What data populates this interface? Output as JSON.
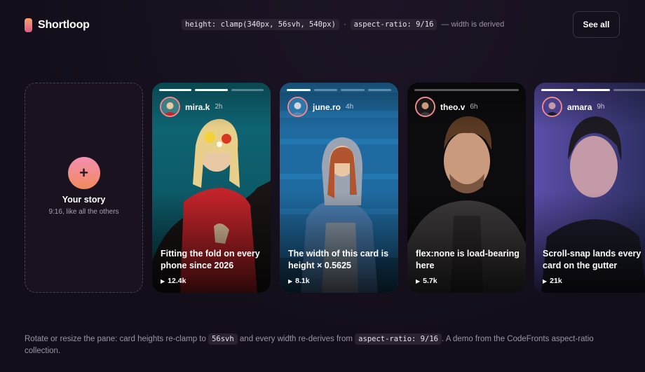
{
  "app": {
    "name": "Shortloop"
  },
  "header": {
    "code_height": "height: clamp(340px, 56svh, 540px)",
    "separator": "·",
    "code_ratio": "aspect-ratio: 9/16",
    "derived_note": "— width is derived",
    "see_all_label": "See all"
  },
  "your_story": {
    "plus": "+",
    "title": "Your story",
    "subtitle": "9:16, like all the others"
  },
  "stories": [
    {
      "user": "mira.k",
      "age": "2h",
      "caption": "Fitting the fold on every phone since 2026",
      "views": "12.4k",
      "progress": [
        1,
        1,
        0
      ]
    },
    {
      "user": "june.ro",
      "age": "4h",
      "caption": "The width of this card is height × 0.5625",
      "views": "8.1k",
      "progress": [
        1,
        0,
        0,
        0
      ]
    },
    {
      "user": "theo.v",
      "age": "6h",
      "caption": "flex:none is load-bearing here",
      "views": "5.7k",
      "progress": [
        0
      ]
    },
    {
      "user": "amara",
      "age": "9h",
      "caption": "Scroll-snap lands every card on the gutter",
      "views": "21k",
      "progress": [
        1,
        1,
        0
      ]
    }
  ],
  "play_icon": "▶",
  "footer": {
    "text1": "Rotate or resize the pane: card heights re-clamp to",
    "code1": "56svh",
    "text2": "and every width re-derives from",
    "code2": "aspect-ratio: 9/16",
    "text3": ". A demo from the CodeFronts aspect-ratio collection."
  }
}
